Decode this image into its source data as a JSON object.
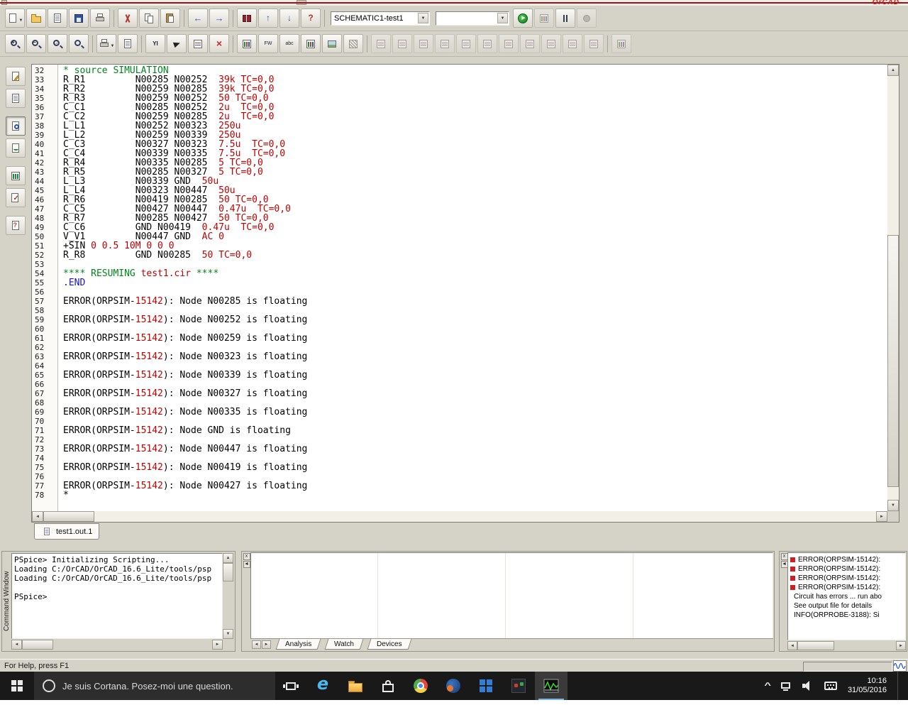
{
  "window": {
    "brand": "OrCAD",
    "status_bar_text": "For Help, press F1"
  },
  "toolbars": {
    "row1": [
      {
        "name": "new-file-button",
        "icon": "page",
        "dropdown": true
      },
      {
        "name": "open-file-button",
        "icon": "folder"
      },
      {
        "name": "append-file-button",
        "icon": "page2"
      },
      {
        "name": "save-button",
        "icon": "floppy"
      },
      {
        "name": "print-button",
        "icon": "printer"
      },
      {
        "type": "sep"
      },
      {
        "name": "cut-button",
        "icon": "cut"
      },
      {
        "name": "copy-button",
        "icon": "copy"
      },
      {
        "name": "paste-button",
        "icon": "paste"
      },
      {
        "type": "sep"
      },
      {
        "name": "undo-button",
        "icon": "undo"
      },
      {
        "name": "redo-button",
        "icon": "redo"
      },
      {
        "type": "sep"
      },
      {
        "name": "simulation-queue-button",
        "icon": "book"
      },
      {
        "name": "move-up-button",
        "icon": "arrup"
      },
      {
        "name": "move-down-button",
        "icon": "arrdown"
      },
      {
        "name": "help-button",
        "icon": "qmark"
      },
      {
        "type": "sep"
      },
      {
        "type": "combo",
        "name": "simulation-profile-combo",
        "value": "SCHEMATIC1-test1",
        "width": 140
      },
      {
        "type": "combo",
        "name": "run-profile-combo",
        "value": "",
        "width": 104
      },
      {
        "name": "run-button",
        "icon": "play"
      },
      {
        "name": "view-results-button",
        "icon": "chart",
        "disabled": true
      },
      {
        "name": "pause-button",
        "icon": "pause"
      },
      {
        "name": "stop-button",
        "icon": "stop",
        "disabled": true
      }
    ],
    "row2": [
      {
        "name": "zoom-in-button",
        "icon": "zoomin"
      },
      {
        "name": "zoom-out-button",
        "icon": "zoomout"
      },
      {
        "name": "zoom-area-button",
        "icon": "zoomarea"
      },
      {
        "name": "zoom-fit-button",
        "icon": "zoomfit"
      },
      {
        "type": "sep"
      },
      {
        "name": "copy-plot-button",
        "icon": "printer",
        "dropdown": true
      },
      {
        "name": "view-log-button",
        "icon": "page2"
      },
      {
        "type": "sep"
      },
      {
        "name": "add-y-axis-button",
        "icon": "yi"
      },
      {
        "name": "toggle-cursor-button",
        "icon": "pointer"
      },
      {
        "name": "mark-data-points-button",
        "icon": "meas"
      },
      {
        "name": "delete-plot-button",
        "icon": "xred"
      },
      {
        "type": "sep"
      },
      {
        "name": "add-trace-button",
        "icon": "chart"
      },
      {
        "name": "fourier-button",
        "icon": "fw"
      },
      {
        "name": "text-label-button",
        "icon": "text"
      },
      {
        "name": "log-x-axis-button",
        "icon": "chart"
      },
      {
        "name": "insert-picture-button",
        "icon": "img"
      },
      {
        "name": "performance-analysis-button",
        "icon": "hatch"
      },
      {
        "type": "sep"
      },
      {
        "name": "cursor-peak-button",
        "icon": "meas",
        "disabled": true
      },
      {
        "name": "cursor-trough-button",
        "icon": "meas",
        "disabled": true
      },
      {
        "name": "cursor-slope-button",
        "icon": "meas",
        "disabled": true
      },
      {
        "name": "cursor-min-button",
        "icon": "meas",
        "disabled": true
      },
      {
        "name": "cursor-max-button",
        "icon": "meas",
        "disabled": true
      },
      {
        "name": "cursor-point-button",
        "icon": "meas",
        "disabled": true
      },
      {
        "name": "cursor-search-button",
        "icon": "meas",
        "disabled": true
      },
      {
        "name": "cursor-next-transition-button",
        "icon": "meas",
        "disabled": true
      },
      {
        "name": "cursor-previous-transition-button",
        "icon": "meas",
        "disabled": true
      },
      {
        "name": "eval-goal-function-button",
        "icon": "meas",
        "disabled": true
      },
      {
        "name": "mark-label-button",
        "icon": "meas",
        "disabled": true
      },
      {
        "type": "sep"
      },
      {
        "name": "view-measurement-button",
        "icon": "chart",
        "disabled": true
      }
    ],
    "left": [
      {
        "name": "view-circuit-file-button",
        "icon": "pagep"
      },
      {
        "name": "view-netlist-button",
        "icon": "page2"
      },
      {
        "name": "view-output-file-button",
        "icon": "pagez",
        "active": true,
        "gap": true
      },
      {
        "name": "view-simulation-results-button",
        "icon": "pagew"
      },
      {
        "name": "view-simulation-queue-button",
        "icon": "chartg",
        "gap": true
      },
      {
        "name": "view-output-window-button",
        "icon": "pagesck"
      },
      {
        "name": "view-command-window-button",
        "icon": "pageq",
        "gap": true
      }
    ]
  },
  "editor": {
    "tab_label": "test1.out.1",
    "lines": [
      {
        "n": 32,
        "s": [
          [
            "g",
            "* source SIMULATION"
          ]
        ]
      },
      {
        "n": 33,
        "s": [
          [
            "k",
            "R_R1         N00285 N00252  "
          ],
          [
            "r",
            "39k TC=0,0"
          ]
        ]
      },
      {
        "n": 34,
        "s": [
          [
            "k",
            "R_R2         N00259 N00285  "
          ],
          [
            "r",
            "39k TC=0,0"
          ]
        ]
      },
      {
        "n": 35,
        "s": [
          [
            "k",
            "R_R3         N00259 N00252  "
          ],
          [
            "r",
            "50 TC=0,0"
          ]
        ]
      },
      {
        "n": 36,
        "s": [
          [
            "k",
            "C_C1         N00285 N00252  "
          ],
          [
            "r",
            "2u  TC=0,0"
          ]
        ]
      },
      {
        "n": 37,
        "s": [
          [
            "k",
            "C_C2         N00259 N00285  "
          ],
          [
            "r",
            "2u  TC=0,0"
          ]
        ]
      },
      {
        "n": 38,
        "s": [
          [
            "k",
            "L_L1         N00252 N00323  "
          ],
          [
            "r",
            "250u"
          ]
        ]
      },
      {
        "n": 39,
        "s": [
          [
            "k",
            "L_L2         N00259 N00339  "
          ],
          [
            "r",
            "250u"
          ]
        ]
      },
      {
        "n": 40,
        "s": [
          [
            "k",
            "C_C3         N00327 N00323  "
          ],
          [
            "r",
            "7.5u  TC=0,0"
          ]
        ]
      },
      {
        "n": 41,
        "s": [
          [
            "k",
            "C_C4         N00339 N00335  "
          ],
          [
            "r",
            "7.5u  TC=0,0"
          ]
        ]
      },
      {
        "n": 42,
        "s": [
          [
            "k",
            "R_R4         N00335 N00285  "
          ],
          [
            "r",
            "5 TC=0,0"
          ]
        ]
      },
      {
        "n": 43,
        "s": [
          [
            "k",
            "R_R5         N00285 N00327  "
          ],
          [
            "r",
            "5 TC=0,0"
          ]
        ]
      },
      {
        "n": 44,
        "s": [
          [
            "k",
            "L_L3         N00339 GND  "
          ],
          [
            "r",
            "50u"
          ]
        ]
      },
      {
        "n": 45,
        "s": [
          [
            "k",
            "L_L4         N00323 N00447  "
          ],
          [
            "r",
            "50u"
          ]
        ]
      },
      {
        "n": 46,
        "s": [
          [
            "k",
            "R_R6         N00419 N00285  "
          ],
          [
            "r",
            "50 TC=0,0"
          ]
        ]
      },
      {
        "n": 47,
        "s": [
          [
            "k",
            "C_C5         N00427 N00447  "
          ],
          [
            "r",
            "0.47u  TC=0,0"
          ]
        ]
      },
      {
        "n": 48,
        "s": [
          [
            "k",
            "R_R7         N00285 N00427  "
          ],
          [
            "r",
            "50 TC=0,0"
          ]
        ]
      },
      {
        "n": 49,
        "s": [
          [
            "k",
            "C_C6         GND N00419  "
          ],
          [
            "r",
            "0.47u  TC=0,0"
          ]
        ]
      },
      {
        "n": 50,
        "s": [
          [
            "k",
            "V_V1         N00447 GND  "
          ],
          [
            "r",
            "AC 0"
          ]
        ]
      },
      {
        "n": 51,
        "s": [
          [
            "k",
            "+SIN "
          ],
          [
            "r",
            "0 0.5 10M 0 0 0"
          ]
        ]
      },
      {
        "n": 52,
        "s": [
          [
            "k",
            "R_R8         GND N00285  "
          ],
          [
            "r",
            "50 TC=0,0"
          ]
        ]
      },
      {
        "n": 53,
        "s": []
      },
      {
        "n": 54,
        "s": [
          [
            "g",
            "**** RESUMING "
          ],
          [
            "r",
            "test1.cir"
          ],
          [
            "g",
            " ****"
          ]
        ]
      },
      {
        "n": 55,
        "s": [
          [
            "b",
            ".END"
          ]
        ]
      },
      {
        "n": 56,
        "s": []
      },
      {
        "n": 57,
        "s": [
          [
            "k",
            "ERROR(ORPSIM-"
          ],
          [
            "r",
            "15142"
          ],
          [
            "k",
            "): Node N00285 is floating"
          ]
        ]
      },
      {
        "n": 58,
        "s": []
      },
      {
        "n": 59,
        "s": [
          [
            "k",
            "ERROR(ORPSIM-"
          ],
          [
            "r",
            "15142"
          ],
          [
            "k",
            "): Node N00252 is floating"
          ]
        ]
      },
      {
        "n": 60,
        "s": []
      },
      {
        "n": 61,
        "s": [
          [
            "k",
            "ERROR(ORPSIM-"
          ],
          [
            "r",
            "15142"
          ],
          [
            "k",
            "): Node N00259 is floating"
          ]
        ]
      },
      {
        "n": 62,
        "s": []
      },
      {
        "n": 63,
        "s": [
          [
            "k",
            "ERROR(ORPSIM-"
          ],
          [
            "r",
            "15142"
          ],
          [
            "k",
            "): Node N00323 is floating"
          ]
        ]
      },
      {
        "n": 64,
        "s": []
      },
      {
        "n": 65,
        "s": [
          [
            "k",
            "ERROR(ORPSIM-"
          ],
          [
            "r",
            "15142"
          ],
          [
            "k",
            "): Node N00339 is floating"
          ]
        ]
      },
      {
        "n": 66,
        "s": []
      },
      {
        "n": 67,
        "s": [
          [
            "k",
            "ERROR(ORPSIM-"
          ],
          [
            "r",
            "15142"
          ],
          [
            "k",
            "): Node N00327 is floating"
          ]
        ]
      },
      {
        "n": 68,
        "s": []
      },
      {
        "n": 69,
        "s": [
          [
            "k",
            "ERROR(ORPSIM-"
          ],
          [
            "r",
            "15142"
          ],
          [
            "k",
            "): Node N00335 is floating"
          ]
        ]
      },
      {
        "n": 70,
        "s": []
      },
      {
        "n": 71,
        "s": [
          [
            "k",
            "ERROR(ORPSIM-"
          ],
          [
            "r",
            "15142"
          ],
          [
            "k",
            "): Node GND is floating"
          ]
        ]
      },
      {
        "n": 72,
        "s": []
      },
      {
        "n": 73,
        "s": [
          [
            "k",
            "ERROR(ORPSIM-"
          ],
          [
            "r",
            "15142"
          ],
          [
            "k",
            "): Node N00447 is floating"
          ]
        ]
      },
      {
        "n": 74,
        "s": []
      },
      {
        "n": 75,
        "s": [
          [
            "k",
            "ERROR(ORPSIM-"
          ],
          [
            "r",
            "15142"
          ],
          [
            "k",
            "): Node N00419 is floating"
          ]
        ]
      },
      {
        "n": 76,
        "s": []
      },
      {
        "n": 77,
        "s": [
          [
            "k",
            "ERROR(ORPSIM-"
          ],
          [
            "r",
            "15142"
          ],
          [
            "k",
            "): Node N00427 is floating"
          ]
        ]
      },
      {
        "n": 78,
        "s": [
          [
            "k",
            "*"
          ]
        ]
      }
    ]
  },
  "command_window": {
    "title": "Command Window",
    "lines": [
      "PSpice> Initializing Scripting...",
      "Loading C:/OrCAD/OrCAD_16.6_Lite/tools/psp",
      "Loading C:/OrCAD/OrCAD_16.6_Lite/tools/psp",
      "",
      "PSpice>"
    ]
  },
  "watch_panel": {
    "tabs": [
      "Analysis",
      "Watch",
      "Devices"
    ]
  },
  "message_panel": {
    "items": [
      {
        "bullet": true,
        "text": "ERROR(ORPSIM-15142):"
      },
      {
        "bullet": true,
        "text": "ERROR(ORPSIM-15142):"
      },
      {
        "bullet": true,
        "text": "ERROR(ORPSIM-15142):"
      },
      {
        "bullet": true,
        "text": "ERROR(ORPSIM-15142):"
      },
      {
        "bullet": false,
        "text": "Circuit has errors ... run abo"
      },
      {
        "bullet": false,
        "text": "See output file for details"
      },
      {
        "bullet": false,
        "text": "INFO(ORPROBE-3188): Si"
      }
    ]
  },
  "taskbar": {
    "search_text": "Je suis Cortana. Posez-moi une question.",
    "apps": [
      {
        "name": "taskbar-icon-edge",
        "kind": "edge"
      },
      {
        "name": "taskbar-icon-file-explorer",
        "kind": "folder"
      },
      {
        "name": "taskbar-icon-store",
        "kind": "store"
      },
      {
        "name": "taskbar-icon-chrome",
        "kind": "chrome"
      },
      {
        "name": "taskbar-icon-browser",
        "kind": "globe"
      },
      {
        "name": "taskbar-icon-app-grid",
        "kind": "grid"
      },
      {
        "name": "taskbar-icon-orcad-capture",
        "kind": "colored"
      },
      {
        "name": "taskbar-icon-pspice",
        "kind": "pspice",
        "active": true
      }
    ],
    "clock": {
      "time": "10:16",
      "date": "31/05/2016"
    }
  }
}
